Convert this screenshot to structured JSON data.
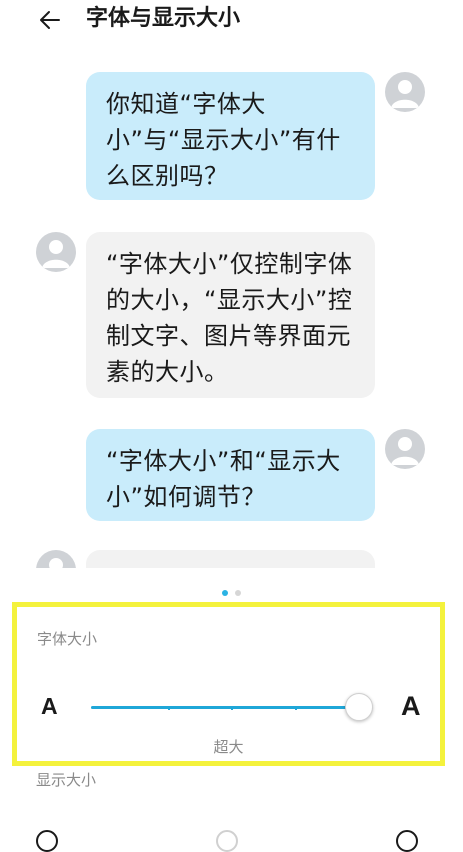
{
  "header": {
    "title": "字体与显示大小"
  },
  "preview": {
    "messages": [
      {
        "from": "me",
        "text": "你知道“字体大小”与“显示大小”有什么区别吗？"
      },
      {
        "from": "other",
        "text": "“字体大小”仅控制字体的大小，“显示大小”控制文字、图片等界面元素的大小。"
      },
      {
        "from": "me",
        "text": "“字体大小”和“显示大小”如何调节？"
      }
    ],
    "pages_total": 2,
    "page_current": 1
  },
  "font_size": {
    "label": "字体大小",
    "small_glyph": "A",
    "large_glyph": "A",
    "value_label": "超大",
    "steps_total": 5,
    "step_selected": 4,
    "accent_color": "#1fa7d8"
  },
  "display_size": {
    "label": "显示大小"
  },
  "colors": {
    "bubble_me": "#c9ecfb",
    "bubble_other": "#f2f2f2",
    "highlight_border": "#f4f23c"
  }
}
